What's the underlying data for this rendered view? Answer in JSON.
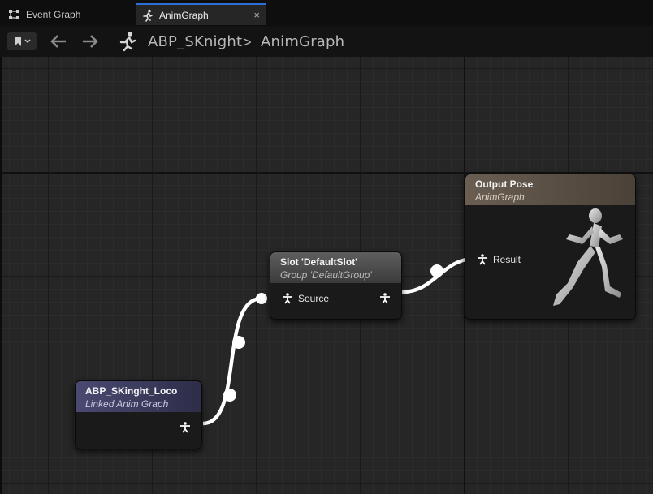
{
  "tabs": [
    {
      "label": "Event Graph",
      "active": false,
      "icon": "event-graph-icon"
    },
    {
      "label": "AnimGraph",
      "active": true,
      "icon": "running-man-icon",
      "close_glyph": "×"
    }
  ],
  "breadcrumb": {
    "items": [
      "ABP_SKnight",
      "AnimGraph"
    ],
    "separator": ">"
  },
  "nodes": {
    "loco": {
      "title": "ABP_SKinght_Loco",
      "subtitle": "Linked Anim Graph",
      "header_color": "#4a4a72"
    },
    "slot": {
      "title": "Slot 'DefaultSlot'",
      "subtitle": "Group 'DefaultGroup'",
      "input_pin": "Source",
      "header_color": "#5e5e5e"
    },
    "output": {
      "title": "Output Pose",
      "subtitle": "AnimGraph",
      "input_pin": "Result",
      "header_color": "#6a5e52"
    }
  },
  "colors": {
    "accent": "#2e6fd8",
    "wire": "#ffffff",
    "graph_bg": "#262626"
  }
}
